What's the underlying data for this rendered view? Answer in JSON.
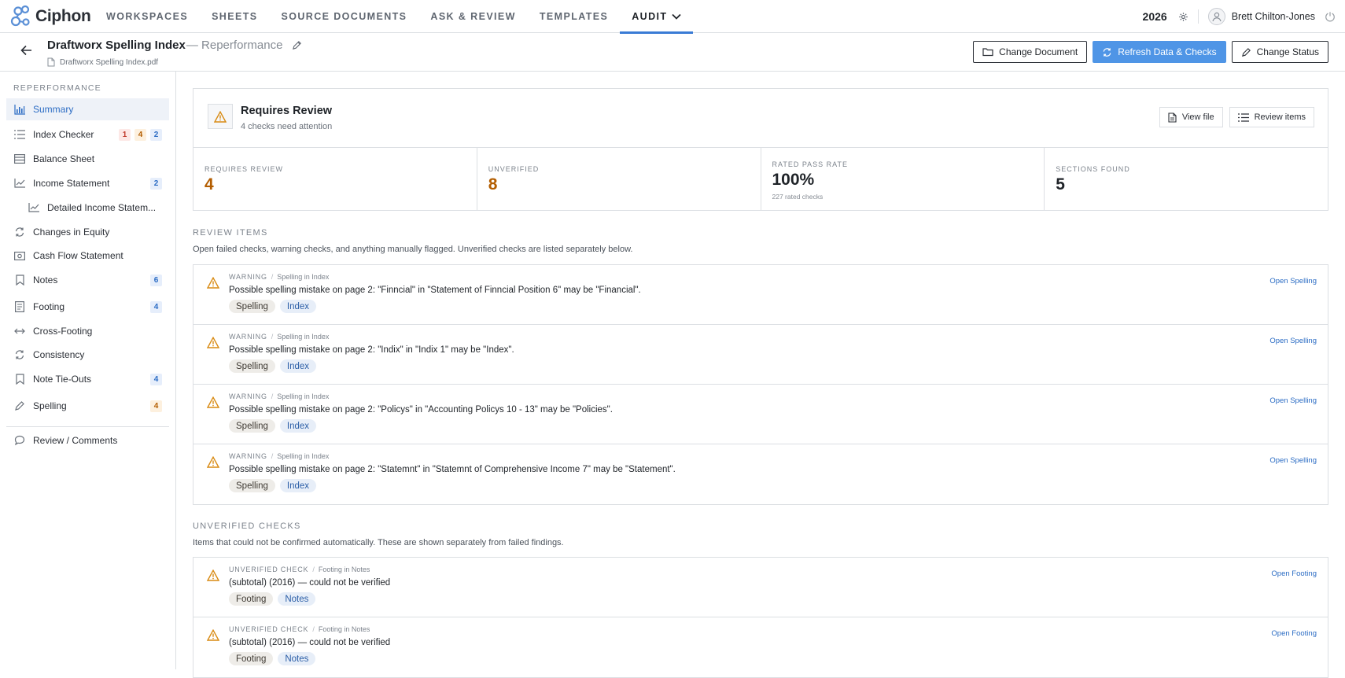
{
  "app": {
    "brand": "Ciphon"
  },
  "nav": {
    "items": [
      {
        "label": "WORKSPACES"
      },
      {
        "label": "SHEETS"
      },
      {
        "label": "SOURCE DOCUMENTS"
      },
      {
        "label": "ASK & REVIEW"
      },
      {
        "label": "TEMPLATES"
      },
      {
        "label": "AUDIT"
      }
    ],
    "year": "2026",
    "user": "Brett Chilton-Jones"
  },
  "doc": {
    "title": "Draftworx Spelling Index",
    "subtitle": "— Reperformance",
    "file": "Draftworx Spelling Index.pdf",
    "buttons": {
      "change_document": "Change Document",
      "refresh": "Refresh Data & Checks",
      "change_status": "Change Status"
    }
  },
  "sidebar": {
    "heading": "REPERFORMANCE",
    "items": [
      {
        "label": "Summary"
      },
      {
        "label": "Index Checker",
        "badges": [
          "1",
          "4",
          "2"
        ]
      },
      {
        "label": "Balance Sheet"
      },
      {
        "label": "Income Statement",
        "badges": [
          "2"
        ]
      },
      {
        "label": "Detailed Income Statem..."
      },
      {
        "label": "Changes in Equity"
      },
      {
        "label": "Cash Flow Statement"
      },
      {
        "label": "Notes",
        "badges": [
          "6"
        ]
      },
      {
        "label": "Footing",
        "badges": [
          "4"
        ]
      },
      {
        "label": "Cross-Footing"
      },
      {
        "label": "Consistency"
      },
      {
        "label": "Note Tie-Outs",
        "badges": [
          "4"
        ]
      },
      {
        "label": "Spelling",
        "badges": [
          "4"
        ]
      },
      {
        "label": "Review / Comments"
      }
    ]
  },
  "summary": {
    "title": "Requires Review",
    "subtitle": "4 checks need attention",
    "view_file": "View file",
    "review_items": "Review items",
    "stats": [
      {
        "label": "REQUIRES REVIEW",
        "value": "4"
      },
      {
        "label": "UNVERIFIED",
        "value": "8"
      },
      {
        "label": "RATED PASS RATE",
        "value": "100%",
        "note": "227 rated checks"
      },
      {
        "label": "SECTIONS FOUND",
        "value": "5"
      }
    ]
  },
  "review": {
    "title": "REVIEW ITEMS",
    "desc": "Open failed checks, warning checks, and anything manually flagged. Unverified checks are listed separately below.",
    "items": [
      {
        "kind": "WARNING",
        "category": "Spelling in Index",
        "message": "Possible spelling mistake on page 2: \"Finncial\" in \"Statement of Finncial Position 6\" may be \"Financial\".",
        "tags": [
          "Spelling",
          "Index"
        ],
        "action": "Open Spelling"
      },
      {
        "kind": "WARNING",
        "category": "Spelling in Index",
        "message": "Possible spelling mistake on page 2: \"Indix\" in \"Indix 1\" may be \"Index\".",
        "tags": [
          "Spelling",
          "Index"
        ],
        "action": "Open Spelling"
      },
      {
        "kind": "WARNING",
        "category": "Spelling in Index",
        "message": "Possible spelling mistake on page 2: \"Policys\" in \"Accounting Policys 10 - 13\" may be \"Policies\".",
        "tags": [
          "Spelling",
          "Index"
        ],
        "action": "Open Spelling"
      },
      {
        "kind": "WARNING",
        "category": "Spelling in Index",
        "message": "Possible spelling mistake on page 2: \"Statemnt\" in \"Statemnt of Comprehensive Income 7\" may be \"Statement\".",
        "tags": [
          "Spelling",
          "Index"
        ],
        "action": "Open Spelling"
      }
    ]
  },
  "unverified": {
    "title": "UNVERIFIED CHECKS",
    "desc": "Items that could not be confirmed automatically. These are shown separately from failed findings.",
    "items": [
      {
        "kind": "UNVERIFIED CHECK",
        "category": "Footing in Notes",
        "message": "(subtotal) (2016) — could not be verified",
        "tags": [
          "Footing",
          "Notes"
        ],
        "action": "Open Footing"
      },
      {
        "kind": "UNVERIFIED CHECK",
        "category": "Footing in Notes",
        "message": "(subtotal) (2016) — could not be verified",
        "tags": [
          "Footing",
          "Notes"
        ],
        "action": "Open Footing"
      }
    ]
  },
  "colors": {
    "accent": "#4f95e6",
    "warning": "#d88a12",
    "link": "#2b6cc4"
  }
}
